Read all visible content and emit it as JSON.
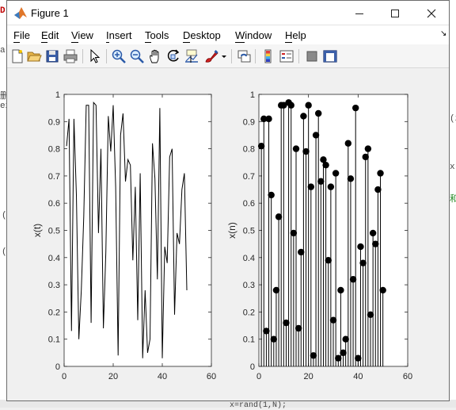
{
  "window": {
    "title": "Figure 1",
    "minimize_icon": "minimize-icon",
    "maximize_icon": "maximize-icon",
    "close_icon": "close-icon"
  },
  "menubar": {
    "items": [
      {
        "label": "File",
        "key": "F"
      },
      {
        "label": "Edit",
        "key": "E"
      },
      {
        "label": "View",
        "key": "V"
      },
      {
        "label": "Insert",
        "key": "I"
      },
      {
        "label": "Tools",
        "key": "T"
      },
      {
        "label": "Desktop",
        "key": "D"
      },
      {
        "label": "Window",
        "key": "W"
      },
      {
        "label": "Help",
        "key": "H"
      }
    ],
    "dock_glyph": "↘"
  },
  "toolbar": {
    "icons": [
      "new-figure-icon",
      "open-file-icon",
      "save-icon",
      "print-icon",
      "edit-plot-icon",
      "zoom-in-icon",
      "zoom-out-icon",
      "pan-icon",
      "rotate-3d-icon",
      "data-cursor-icon",
      "brush-icon",
      "link-plot-icon",
      "colorbar-icon",
      "legend-icon",
      "hide-plot-tools-icon",
      "show-plot-tools-icon"
    ]
  },
  "background": {
    "fragments": [
      "D",
      "a",
      "删",
      "ex",
      "(",
      "(",
      "(z",
      "x",
      "和",
      "x=rand(1,N);"
    ]
  },
  "chart_data": [
    {
      "type": "line",
      "title": "",
      "xlabel": "",
      "ylabel": "x(t)",
      "xlim": [
        0,
        60
      ],
      "ylim": [
        0,
        1
      ],
      "xticks": [
        0,
        20,
        40,
        60
      ],
      "yticks": [
        0,
        0.1,
        0.2,
        0.3,
        0.4,
        0.5,
        0.6,
        0.7,
        0.8,
        0.9,
        1
      ],
      "grid": false,
      "series": [
        {
          "color": "#000000",
          "x": [
            1,
            2,
            3,
            4,
            5,
            6,
            7,
            8,
            9,
            10,
            11,
            12,
            13,
            14,
            15,
            16,
            17,
            18,
            19,
            20,
            21,
            22,
            23,
            24,
            25,
            26,
            27,
            28,
            29,
            30,
            31,
            32,
            33,
            34,
            35,
            36,
            37,
            38,
            39,
            40,
            41,
            42,
            43,
            44,
            45,
            46,
            47,
            48,
            49,
            50
          ],
          "values": [
            0.81,
            0.91,
            0.13,
            0.91,
            0.63,
            0.1,
            0.28,
            0.55,
            0.96,
            0.96,
            0.16,
            0.97,
            0.96,
            0.49,
            0.8,
            0.14,
            0.42,
            0.92,
            0.79,
            0.96,
            0.66,
            0.04,
            0.85,
            0.93,
            0.68,
            0.76,
            0.74,
            0.39,
            0.66,
            0.17,
            0.71,
            0.03,
            0.28,
            0.05,
            0.1,
            0.82,
            0.69,
            0.32,
            0.95,
            0.03,
            0.44,
            0.38,
            0.77,
            0.8,
            0.19,
            0.49,
            0.45,
            0.65,
            0.71,
            0.28
          ]
        }
      ]
    },
    {
      "type": "scatter",
      "style": "stem",
      "title": "",
      "xlabel": "",
      "ylabel": "x(n)",
      "xlim": [
        0,
        60
      ],
      "ylim": [
        0,
        1
      ],
      "xticks": [
        0,
        20,
        40,
        60
      ],
      "yticks": [
        0,
        0.1,
        0.2,
        0.3,
        0.4,
        0.5,
        0.6,
        0.7,
        0.8,
        0.9,
        1
      ],
      "grid": false,
      "series": [
        {
          "color": "#000000",
          "x": [
            1,
            2,
            3,
            4,
            5,
            6,
            7,
            8,
            9,
            10,
            11,
            12,
            13,
            14,
            15,
            16,
            17,
            18,
            19,
            20,
            21,
            22,
            23,
            24,
            25,
            26,
            27,
            28,
            29,
            30,
            31,
            32,
            33,
            34,
            35,
            36,
            37,
            38,
            39,
            40,
            41,
            42,
            43,
            44,
            45,
            46,
            47,
            48,
            49,
            50
          ],
          "values": [
            0.81,
            0.91,
            0.13,
            0.91,
            0.63,
            0.1,
            0.28,
            0.55,
            0.96,
            0.96,
            0.16,
            0.97,
            0.96,
            0.49,
            0.8,
            0.14,
            0.42,
            0.92,
            0.79,
            0.96,
            0.66,
            0.04,
            0.85,
            0.93,
            0.68,
            0.76,
            0.74,
            0.39,
            0.66,
            0.17,
            0.71,
            0.03,
            0.28,
            0.05,
            0.1,
            0.82,
            0.69,
            0.32,
            0.95,
            0.03,
            0.44,
            0.38,
            0.77,
            0.8,
            0.19,
            0.49,
            0.45,
            0.65,
            0.71,
            0.28
          ]
        }
      ]
    }
  ]
}
